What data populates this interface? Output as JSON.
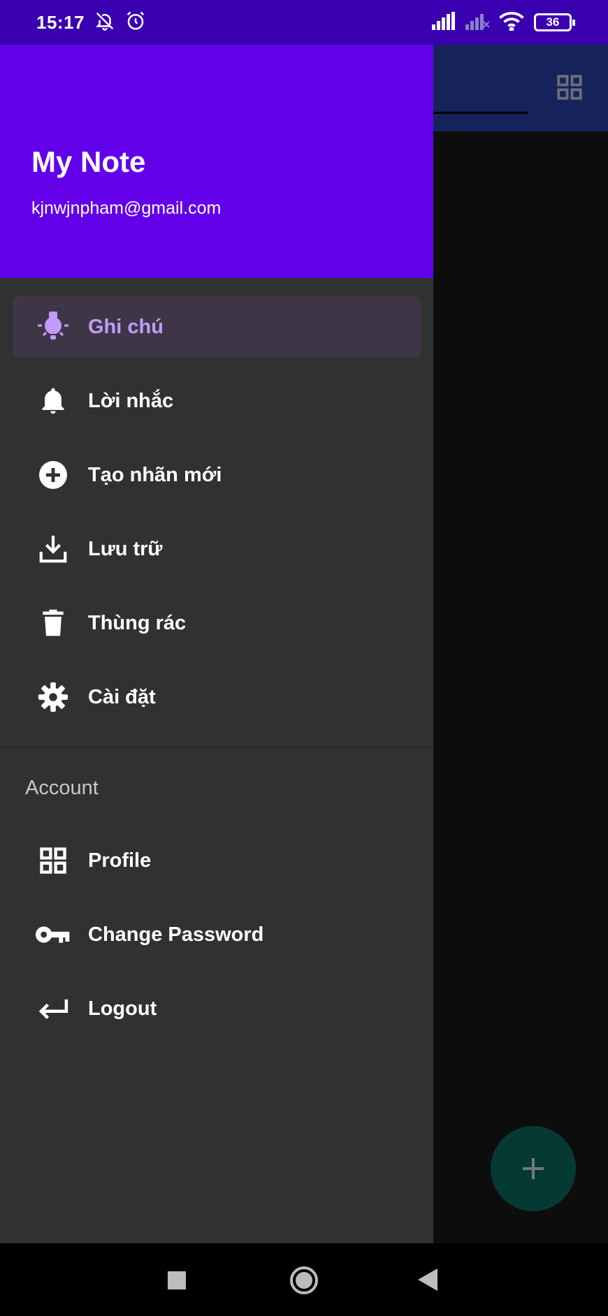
{
  "status_bar": {
    "time": "15:17",
    "battery": "36",
    "icons": [
      "bell-off-icon",
      "alarm-icon",
      "signal-icon",
      "signal-off-icon",
      "wifi-icon",
      "battery-icon"
    ]
  },
  "drawer": {
    "title": "My Note",
    "email": "kjnwjnpham@gmail.com",
    "items": [
      {
        "label": "Ghi chú",
        "icon": "lightbulb-icon",
        "active": true
      },
      {
        "label": "Lời nhắc",
        "icon": "bell-icon"
      },
      {
        "label": "Tạo nhãn mới",
        "icon": "add-circle-icon"
      },
      {
        "label": "Lưu trữ",
        "icon": "download-icon"
      },
      {
        "label": "Thùng rác",
        "icon": "trash-icon"
      },
      {
        "label": "Cài đặt",
        "icon": "gear-icon"
      }
    ],
    "account_section": {
      "label": "Account",
      "items": [
        {
          "label": "Profile",
          "icon": "grid-icon"
        },
        {
          "label": "Change Password",
          "icon": "key-icon"
        },
        {
          "label": "Logout",
          "icon": "logout-arrow-icon"
        }
      ]
    }
  },
  "colors": {
    "header": "#6200ea",
    "drawer_bg": "#313131",
    "active_text": "#c39bff",
    "status_bar": "#3a00b0",
    "fab": "#053a34"
  }
}
